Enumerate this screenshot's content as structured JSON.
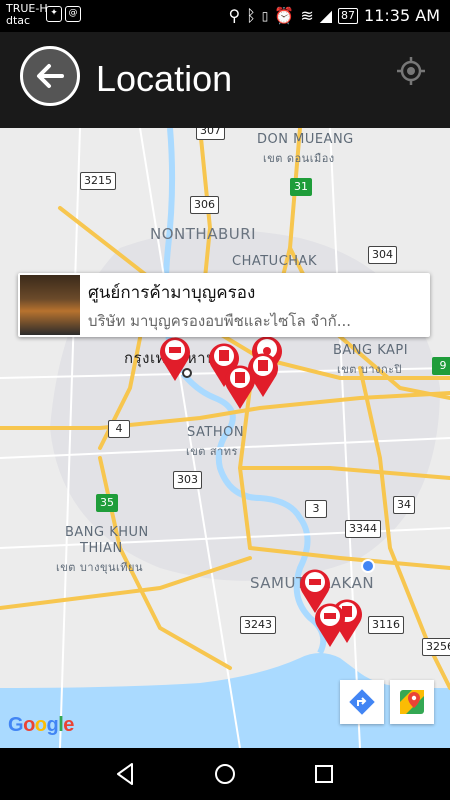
{
  "status_bar": {
    "carrier_1": "TRUE-H",
    "carrier_2": "dtac",
    "battery": "87",
    "time": "11:35 AM",
    "app_icons": [
      "messenger-icon",
      "email-icon"
    ]
  },
  "app_bar": {
    "title": "Location",
    "back_icon": "arrow-back-icon",
    "locate_icon": "gps-target-icon"
  },
  "map": {
    "labels": {
      "don_mueang": "DON MUEANG",
      "don_mueang_th": "เขต ดอนเมือง",
      "nonthaburi": "NONTHABURI",
      "chatuchak": "CHATUCHAK",
      "bangkok_th": "กรุงเทพมหานคร",
      "bang_kapi": "BANG KAPI",
      "bang_kapi_th": "เขต บางกะปิ",
      "sathon": "SATHON",
      "sathon_th": "เขต สาทร",
      "bang_khun_thian_1": "BANG KHUN",
      "bang_khun_thian_2": "THIAN",
      "bang_khun_thian_th": "เขต บางขุนเทียน",
      "samut_prakan": "SAMUT PRAKAN"
    },
    "shields": [
      "307",
      "3215",
      "306",
      "31",
      "304",
      "9",
      "4",
      "303",
      "3",
      "3344",
      "34",
      "35",
      "3243",
      "3116",
      "3256"
    ],
    "popup": {
      "title": "ศูนย์การค้ามาบุญครอง",
      "subtitle": "บริษัท มาบุญครองอบพืชและไซโล จำกั..."
    },
    "attribution": "Google",
    "directions_icon": "directions-icon",
    "google_maps_icon": "google-maps-icon"
  },
  "colors": {
    "pin_red": "#e11d2a",
    "appbar": "#1a1a1a",
    "water": "#aadaff",
    "road_major": "#f7c64f"
  },
  "nav_bar": {
    "back_icon": "nav-back-icon",
    "home_icon": "nav-home-icon",
    "recents_icon": "nav-recents-icon"
  }
}
